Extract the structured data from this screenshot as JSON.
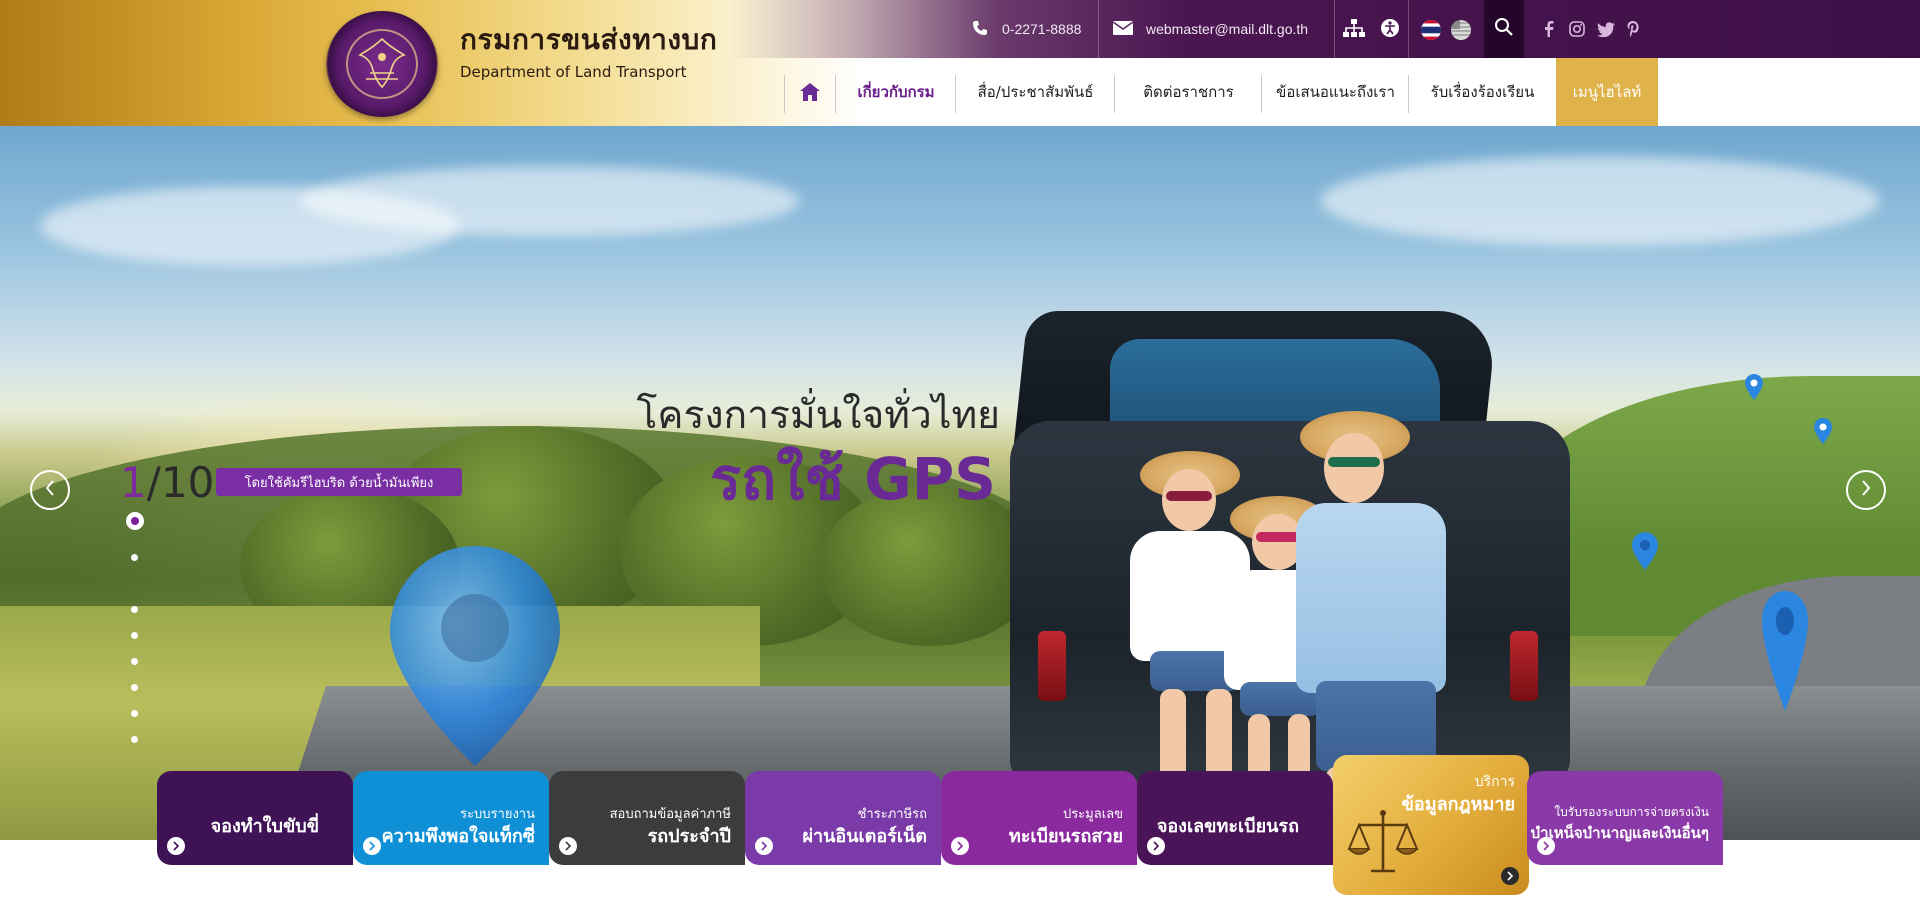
{
  "header": {
    "org_name_th": "กรมการขนส่งทางบก",
    "org_name_en": "Department of Land Transport",
    "phone": "0-2271-8888",
    "email": "webmaster@mail.dlt.go.th",
    "icons": [
      "phone-icon",
      "mail-icon",
      "sitemap-icon",
      "accessibility-icon",
      "thai-flag-icon",
      "english-flag-icon",
      "search-icon"
    ],
    "social": [
      "facebook-icon",
      "instagram-icon",
      "twitter-icon",
      "pinterest-icon"
    ],
    "colors": {
      "topbar": "#3e0f47",
      "gold": "#e0b24a",
      "active_nav": "#6a1e8c"
    }
  },
  "nav": {
    "home_icon": "home-icon",
    "items": [
      {
        "label": "เกี่ยวกับกรม",
        "active": true
      },
      {
        "label": "สื่อ/ประชาสัมพันธ์",
        "active": false
      },
      {
        "label": "ติดต่อราชการ",
        "active": false
      },
      {
        "label": "ข้อเสนอแนะถึงเรา",
        "active": false
      },
      {
        "label": "รับเรื่องร้องเรียน",
        "active": false
      }
    ],
    "highlight": "เมนูไฮไลท์"
  },
  "hero": {
    "counter_current": "1",
    "counter_total": "/10",
    "tag": "โดยใช้คัมรีไฮบริด ด้วยน้ำมันเพียง",
    "title_line1": "โครงการมั่นใจทั่วไทย",
    "title_line2": "รถใช้ GPS",
    "slide_count": 8,
    "active_slide": 1
  },
  "services": [
    {
      "small": "",
      "big": "จองทำใบขับขี่",
      "color": "#3e1255"
    },
    {
      "small": "ระบบรายงาน",
      "big": "ความพึงพอใจแท็กซี่",
      "color": "#0e8fd6"
    },
    {
      "small": "สอบถามข้อมูลค่าภาษี",
      "big": "รถประจำปี",
      "color": "#3c3c3c"
    },
    {
      "small": "ชำระภาษีรถ",
      "big": "ผ่านอินเตอร์เน็ต",
      "color": "#7a3aa8"
    },
    {
      "small": "ประมูลเลข",
      "big": "ทะเบียนรถสวย",
      "color": "#8a2a9e"
    },
    {
      "small": "",
      "big": "จองเลขทะเบียนรถ",
      "color": "#4a1458"
    },
    {
      "small": "บริการ",
      "big": "ข้อมูลกฎหมาย",
      "color": "#e3ad3c"
    },
    {
      "small": "ใบรับรองระบบการจ่ายตรงเงิน",
      "big": "บำเหน็จบำนาญและเงินอื่นๆ",
      "color": "#8a3aa8"
    }
  ]
}
